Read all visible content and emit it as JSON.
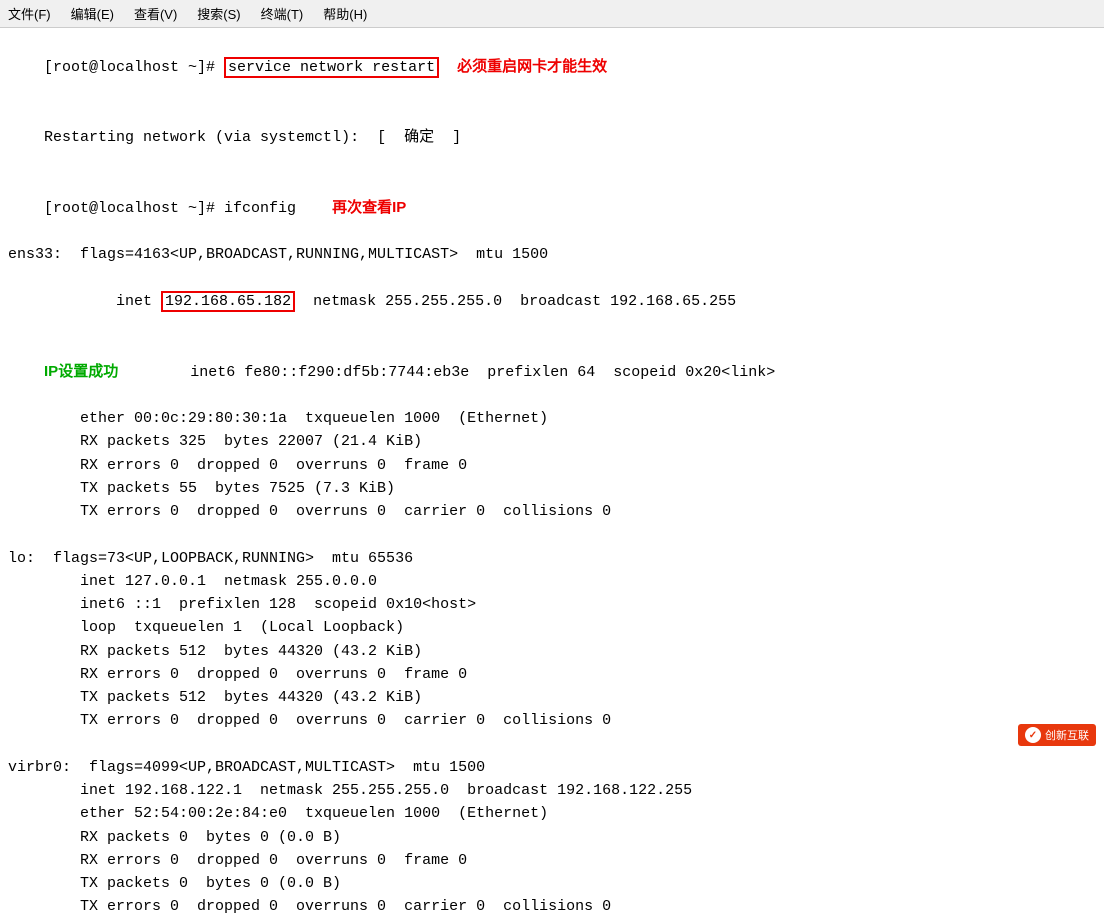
{
  "menubar": {
    "items": [
      {
        "label": "文件(F)"
      },
      {
        "label": "编辑(E)"
      },
      {
        "label": "查看(V)"
      },
      {
        "label": "搜索(S)"
      },
      {
        "label": "终端(T)"
      },
      {
        "label": "帮助(H)"
      }
    ]
  },
  "terminal": {
    "prompt1": "[root@localhost ~]# ",
    "command": "service network restart",
    "annot1": "必须重启网卡才能生效",
    "line2": "Restarting network (via systemctl):  ",
    "ok": "[  确定  ]",
    "prompt2": "[root@localhost ~]# ifconfig",
    "annot2": "再次查看IP",
    "ens33_flags": "ens33:  flags=4163<UP,BROADCAST,RUNNING,MULTICAST>  mtu 1500",
    "inet_line": "        inet 192.168.65.182  netmask 255.255.255.0  broadcast 192.168.65.255",
    "ip_val": "192.168.65.182",
    "annot3": "IP设置成功",
    "inet6_line": "        inet6 fe80::f290:df5b:7744:eb3e  prefixlen 64  scopeid 0x20<link>",
    "ether_line": "        ether 00:0c:29:80:30:1a  txqueuelen 1000  (Ethernet)",
    "rx1": "        RX packets 325  bytes 22007 (21.4 KiB)",
    "rx_err1": "        RX errors 0  dropped 0  overruns 0  frame 0",
    "tx1": "        TX packets 55  bytes 7525 (7.3 KiB)",
    "tx_err1": "        TX errors 0  dropped 0  overruns 0  carrier 0  collisions 0",
    "blank1": "",
    "lo_flags": "lo:  flags=73<UP,LOOPBACK,RUNNING>  mtu 65536",
    "lo_inet": "        inet 127.0.0.1  netmask 255.0.0.0",
    "lo_inet6": "        inet6 ::1  prefixlen 128  scopeid 0x10<host>",
    "lo_loop": "        loop  txqueuelen 1  (Local Loopback)",
    "lo_rx1": "        RX packets 512  bytes 44320 (43.2 KiB)",
    "lo_rx_err": "        RX errors 0  dropped 0  overruns 0  frame 0",
    "lo_tx1": "        TX packets 512  bytes 44320 (43.2 KiB)",
    "lo_tx_err": "        TX errors 0  dropped 0  overruns 0  carrier 0  collisions 0",
    "blank2": "",
    "virbr_flags": "virbr0:  flags=4099<UP,BROADCAST,MULTICAST>  mtu 1500",
    "virbr_inet": "        inet 192.168.122.1  netmask 255.255.255.0  broadcast 192.168.122.255",
    "virbr_ether": "        ether 52:54:00:2e:84:e0  txqueuelen 1000  (Ethernet)",
    "virbr_rx1": "        RX packets 0  bytes 0 (0.0 B)",
    "virbr_rx_err": "        RX errors 0  dropped 0  overruns 0  frame 0",
    "virbr_tx1": "        TX packets 0  bytes 0 (0.0 B)",
    "virbr_tx_err": "        TX errors 0  dropped 0  overruns 0  carrier 0  collisions 0",
    "watermark": "创新互联"
  }
}
